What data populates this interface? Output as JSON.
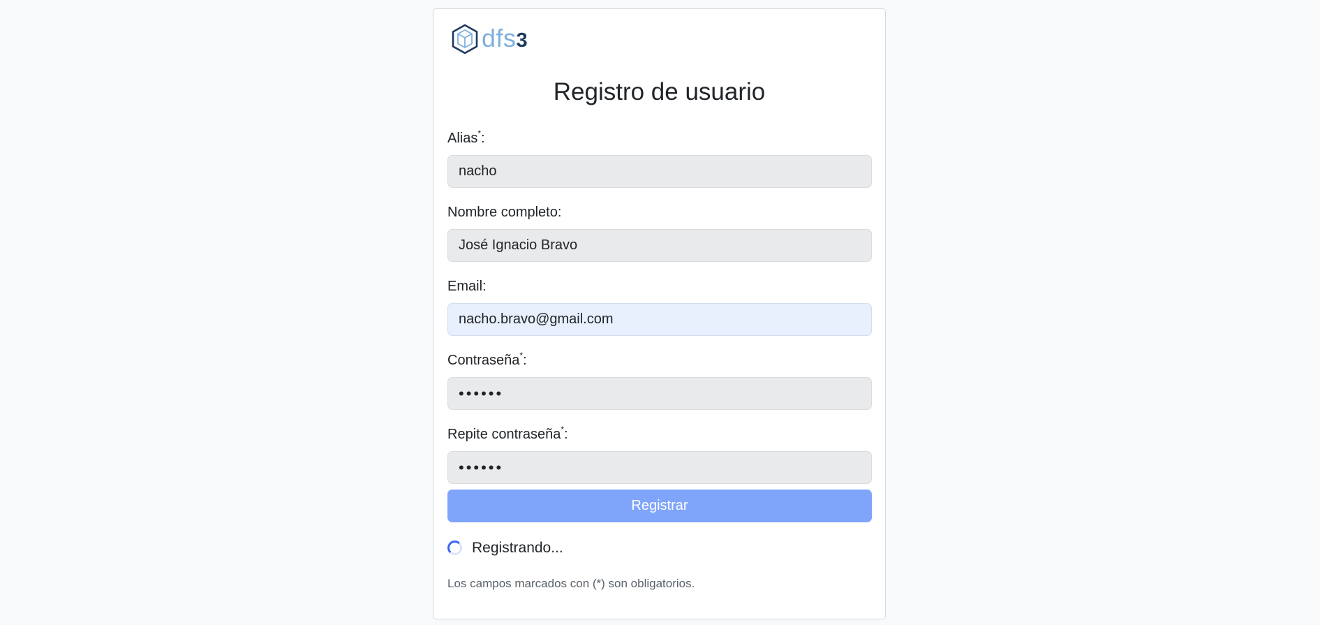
{
  "logo": {
    "text_main": "dfs",
    "text_number": "3",
    "icon": "hexagon-cube-icon"
  },
  "title": "Registro de usuario",
  "fields": {
    "alias": {
      "label": "Alias",
      "required_mark": "*",
      "suffix": ":",
      "value": "nacho"
    },
    "full_name": {
      "label": "Nombre completo:",
      "value": "José Ignacio Bravo"
    },
    "email": {
      "label": "Email:",
      "value": "nacho.bravo@gmail.com"
    },
    "password": {
      "label": "Contraseña",
      "required_mark": "*",
      "suffix": ":",
      "value": "••••••"
    },
    "password_repeat": {
      "label": "Repite contraseña",
      "required_mark": "*",
      "suffix": ":",
      "value": "••••••"
    }
  },
  "submit_label": "Registrar",
  "status_text": "Registrando...",
  "required_note": "Los campos marcados con (*) son obligatorios.",
  "colors": {
    "button": "#7fa5fa",
    "spinner": "#3b66f0",
    "logo_light": "#7eb0de",
    "logo_dark": "#1e3a5f"
  }
}
